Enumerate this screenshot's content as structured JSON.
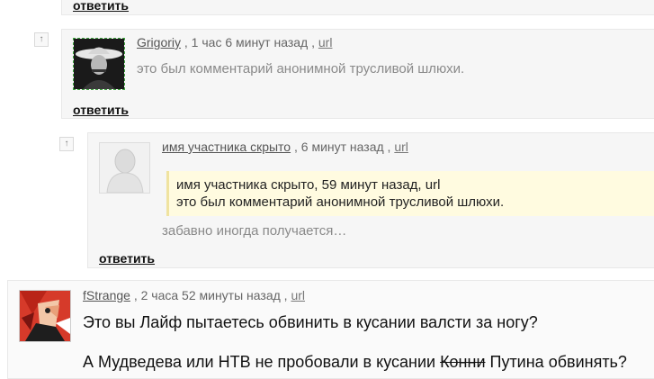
{
  "top_reply": {
    "label": "ответить"
  },
  "comment1": {
    "up_label": "↑",
    "author": "Grigoriy",
    "time": ", 1 час 6 минут назад ,",
    "url": "url",
    "text": "это был комментарий анонимной трусливой шлюхи.",
    "reply_label": "ответить"
  },
  "comment2": {
    "up_label": "↑",
    "author": "имя участника скрыто",
    "time": ", 6 минут назад ,",
    "url": "url",
    "quote_line1": "имя участника скрыто, 59 минут назад, url",
    "quote_line2": "это был комментарий анонимной трусливой шлюхи.",
    "text": "забавно иногда получается…",
    "reply_label": "ответить"
  },
  "comment3": {
    "author": "fStrange",
    "time": ", 2 часа 52 минуты назад ,",
    "url": "url",
    "text1": "Это вы Лайф пытаетесь обвинить в кусании валсти за ногу?",
    "text2_before": "А Мудведева или НТВ не пробовали в кусании ",
    "text2_strike": "Конни",
    "text2_after": " Путина обвинять?"
  }
}
